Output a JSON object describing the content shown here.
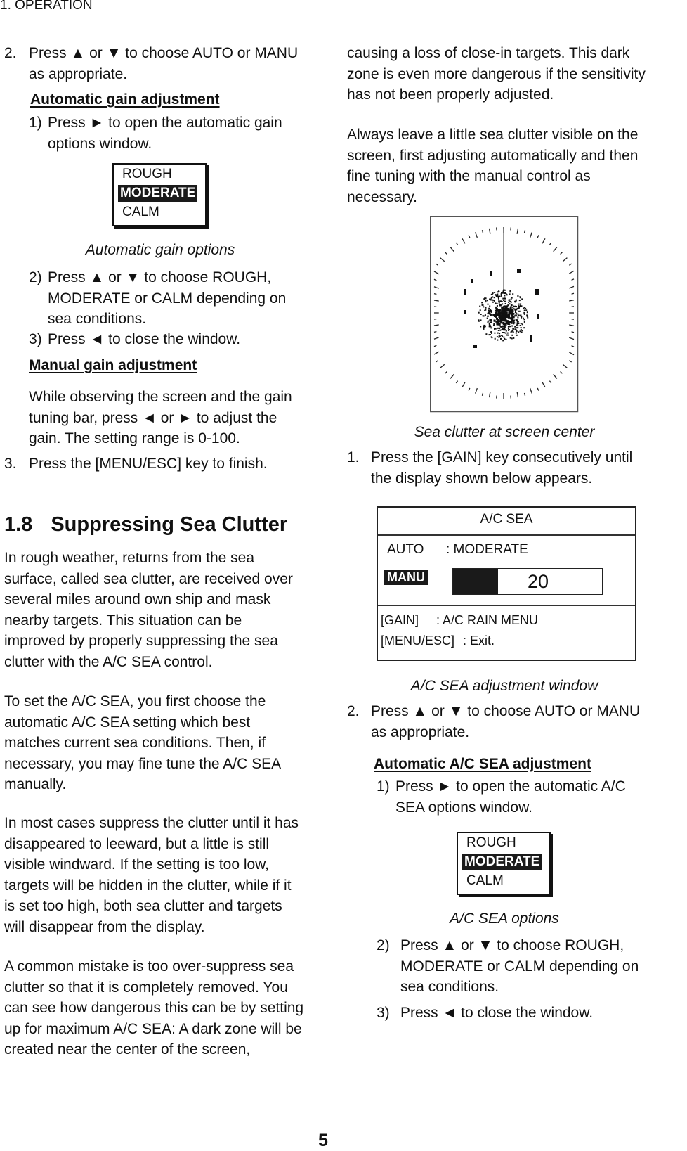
{
  "page": {
    "running_head": "1. OPERATION",
    "page_number": "5"
  },
  "left": {
    "step2": {
      "num": "2.",
      "lines": [
        "Press ▲ or ▼ to choose AUTO or MANU",
        "as appropriate."
      ]
    },
    "auto_gain_heading": "Automatic gain adjustment",
    "auto_gain_step1": {
      "num": "1)",
      "lines": [
        "Press ► to open the automatic gain",
        "options window."
      ]
    },
    "gain_options": {
      "items": [
        "ROUGH",
        "MODERATE",
        "CALM"
      ],
      "selected": "MODERATE",
      "caption": "Automatic gain options"
    },
    "auto_gain_step2": {
      "num": "2)",
      "lines": [
        "Press ▲ or ▼ to choose ROUGH,",
        "MODERATE or CALM depending on",
        "sea conditions."
      ]
    },
    "auto_gain_step3": {
      "num": "3)",
      "lines": [
        "Press ◄ to close the window."
      ]
    },
    "manual_gain_heading": "Manual gain adjustment",
    "manual_gain_text": [
      "While observing the screen and the gain",
      "tuning bar, press ◄ or ► to adjust the",
      "gain. The setting range is 0-100."
    ],
    "step3": {
      "num": "3.",
      "lines": [
        "Press the [MENU/ESC] key to finish."
      ]
    },
    "section": {
      "number": "1.8",
      "title": "Suppressing Sea Clutter"
    },
    "para1": [
      "In rough weather, returns from the sea",
      "surface, called sea clutter, are received over",
      "several miles around own ship and mask",
      "nearby targets. This situation can be",
      "improved by properly suppressing the sea",
      "clutter with the A/C SEA control."
    ],
    "para2": [
      "To set the A/C SEA, you first choose the",
      "automatic A/C SEA setting which best",
      "matches current sea conditions. Then, if",
      "necessary, you may fine tune the A/C SEA",
      "manually."
    ],
    "para3": [
      "In most cases suppress the clutter until it has",
      "disappeared to leeward, but a little is still",
      "visible windward. If the setting is too low,",
      "targets will be hidden in the clutter, while if it",
      "is set too high, both sea clutter and targets",
      "will disappear from the display."
    ],
    "para4": [
      "A common mistake is too over-suppress sea",
      "clutter so that it is completely removed. You",
      "can see how dangerous this can be by setting",
      "up for maximum A/C SEA: A dark zone will be",
      "created near the center of the screen,"
    ]
  },
  "right": {
    "para5": [
      "causing a loss of close-in targets. This dark",
      "zone is even more dangerous if the sensitivity",
      "has not been properly adjusted."
    ],
    "para6": [
      "Always leave a little sea clutter visible on the",
      "screen, first adjusting automatically and then",
      "fine tuning with the manual control as",
      "necessary."
    ],
    "radar_caption": "Sea clutter at screen center",
    "step1": {
      "num": "1.",
      "lines": [
        "Press the [GAIN] key consecutively until",
        "the display shown below appears."
      ]
    },
    "acsea_window": {
      "title": "A/C SEA",
      "auto_label": "AUTO",
      "auto_value": ": MODERATE",
      "manu_label": "MANU",
      "manu_value": "20",
      "manu_range_max": 100,
      "key1": "[GAIN]",
      "key1_desc": ":  A/C RAIN MENU",
      "key2": "[MENU/ESC]",
      "key2_desc": ":  Exit.",
      "caption": "A/C SEA adjustment window"
    },
    "step2": {
      "num": "2.",
      "lines": [
        "Press ▲ or ▼ to choose AUTO or MANU",
        "as appropriate."
      ]
    },
    "auto_sea_heading": "Automatic A/C SEA adjustment",
    "auto_sea_step1": {
      "num": "1)",
      "lines": [
        "Press ► to open the automatic A/C",
        "SEA options window."
      ]
    },
    "sea_options": {
      "items": [
        "ROUGH",
        "MODERATE",
        "CALM"
      ],
      "selected": "MODERATE",
      "caption": "A/C SEA options"
    },
    "auto_sea_step2": {
      "num": "2)",
      "lines": [
        "Press ▲ or ▼ to choose ROUGH,",
        "MODERATE or CALM depending on",
        "sea conditions."
      ]
    },
    "auto_sea_step3": {
      "num": "3)",
      "lines": [
        "Press ◄ to close the window."
      ]
    }
  }
}
